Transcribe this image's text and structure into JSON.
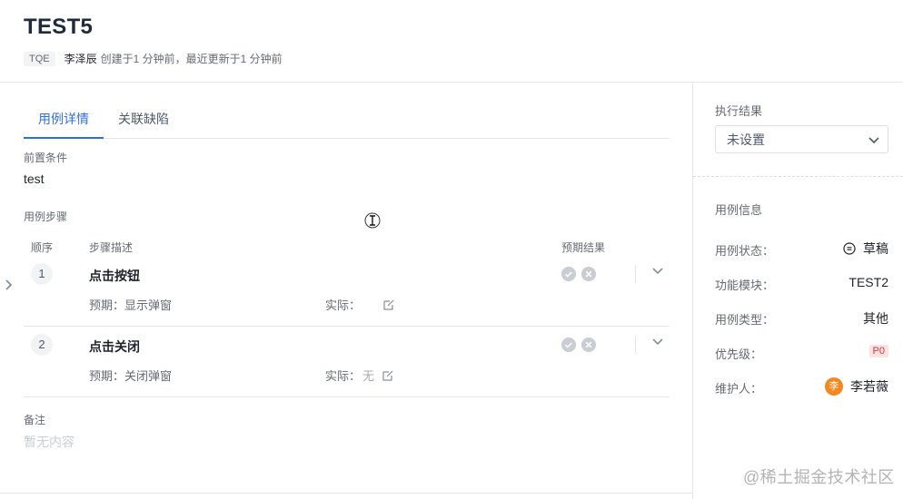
{
  "header": {
    "title": "TEST5",
    "project_tag": "TQE",
    "author": "李泽辰",
    "meta_text": "创建于1 分钟前，最近更新于1 分钟前"
  },
  "tabs": [
    {
      "label": "用例详情",
      "active": true
    },
    {
      "label": "关联缺陷",
      "active": false
    }
  ],
  "main": {
    "precondition_label": "前置条件",
    "precondition_value": "test",
    "steps_label": "用例步骤",
    "columns": {
      "order": "顺序",
      "desc": "步骤描述",
      "expected": "预期结果"
    },
    "steps": [
      {
        "num": "1",
        "title": "点击按钮",
        "expected": "预期：显示弹窗",
        "actual_label": "实际：",
        "actual_value": ""
      },
      {
        "num": "2",
        "title": "点击关闭",
        "expected": "预期：关闭弹窗",
        "actual_label": "实际：",
        "actual_value": "无"
      }
    ],
    "remark_label": "备注",
    "remark_empty": "暂无内容"
  },
  "side": {
    "exec_result_label": "执行结果",
    "exec_result_value": "未设置",
    "info_title": "用例信息",
    "fields": {
      "status_label": "用例状态：",
      "status_value": "草稿",
      "module_label": "功能模块：",
      "module_value": "TEST2",
      "type_label": "用例类型：",
      "type_value": "其他",
      "priority_label": "优先级：",
      "priority_value": "P0",
      "owner_label": "维护人：",
      "owner_avatar": "李",
      "owner_value": "李若薇"
    }
  },
  "watermark": "@稀土掘金技术社区",
  "colors": {
    "accent": "#2f6fe4",
    "avatar": "#f5871f",
    "p0_bg": "#fde2e2",
    "p0_fg": "#d9363e"
  },
  "icons": [
    "pass-icon",
    "fail-icon",
    "chevron-down-icon",
    "edit-icon",
    "draft-status-icon",
    "expand-arrow-icon",
    "text-cursor-icon"
  ]
}
